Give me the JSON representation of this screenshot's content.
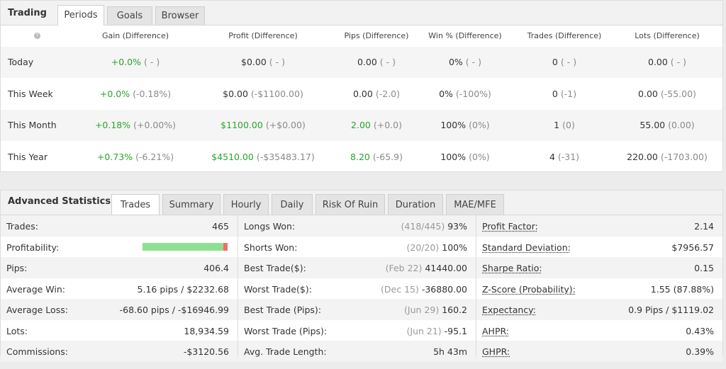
{
  "trading": {
    "title": "Trading",
    "tabs": [
      "Periods",
      "Goals",
      "Browser"
    ],
    "headers": [
      "Gain (Difference)",
      "Profit (Difference)",
      "Pips (Difference)",
      "Win % (Difference)",
      "Trades (Difference)",
      "Lots (Difference)"
    ],
    "rows": [
      {
        "label": "Today",
        "gain": "+0.0%",
        "gain_d": "( - )",
        "profit": "$0.00",
        "profit_d": "( - )",
        "pips": "0.00",
        "pips_d": "( - )",
        "win": "0%",
        "win_d": "( - )",
        "trades": "0",
        "trades_d": "( - )",
        "lots": "0.00",
        "lots_d": "( - )"
      },
      {
        "label": "This Week",
        "gain": "+0.0%",
        "gain_d": "(-0.18%)",
        "profit": "$0.00",
        "profit_d": "(-$1100.00)",
        "pips": "0.00",
        "pips_d": "(-2.0)",
        "win": "0%",
        "win_d": "(-100%)",
        "trades": "0",
        "trades_d": "(-1)",
        "lots": "0.00",
        "lots_d": "(-55.00)"
      },
      {
        "label": "This Month",
        "gain": "+0.18%",
        "gain_d": "(+0.00%)",
        "profit": "$1100.00",
        "profit_d": "(+$0.00)",
        "pips": "2.00",
        "pips_d": "(+0.0)",
        "win": "100%",
        "win_d": "(0%)",
        "trades": "1",
        "trades_d": "(0)",
        "lots": "55.00",
        "lots_d": "(0.00)"
      },
      {
        "label": "This Year",
        "gain": "+0.73%",
        "gain_d": "(-6.21%)",
        "profit": "$4510.00",
        "profit_d": "(-$35483.17)",
        "pips": "8.20",
        "pips_d": "(-65.9)",
        "win": "100%",
        "win_d": "(0%)",
        "trades": "4",
        "trades_d": "(-31)",
        "lots": "220.00",
        "lots_d": "(-1703.00)"
      }
    ]
  },
  "advanced": {
    "title": "Advanced Statistics",
    "tabs": [
      "Trades",
      "Summary",
      "Hourly",
      "Daily",
      "Risk Of Ruin",
      "Duration",
      "MAE/MFE"
    ],
    "col1": [
      {
        "label": "Trades:",
        "value": "465"
      },
      {
        "label": "Profitability:",
        "value": ""
      },
      {
        "label": "Pips:",
        "value": "406.4"
      },
      {
        "label": "Average Win:",
        "value": "5.16 pips / $2232.68"
      },
      {
        "label": "Average Loss:",
        "value": "-68.60 pips / -$16946.99"
      },
      {
        "label": "Lots:",
        "value": "18,934.59"
      },
      {
        "label": "Commissions:",
        "value": "-$3120.56"
      }
    ],
    "profitability_win_fraction": 0.95,
    "col2": [
      {
        "label": "Longs Won:",
        "extra": "(418/445)",
        "value": "93%"
      },
      {
        "label": "Shorts Won:",
        "extra": "(20/20)",
        "value": "100%"
      },
      {
        "label": "Best Trade($):",
        "extra": "(Feb 22)",
        "value": "41440.00"
      },
      {
        "label": "Worst Trade($):",
        "extra": "(Dec 15)",
        "value": "-36880.00"
      },
      {
        "label": "Best Trade (Pips):",
        "extra": "(Jun 29)",
        "value": "160.2"
      },
      {
        "label": "Worst Trade (Pips):",
        "extra": "(Jun 21)",
        "value": "-95.1"
      },
      {
        "label": "Avg. Trade Length:",
        "extra": "",
        "value": "5h 43m"
      }
    ],
    "col3": [
      {
        "label": "Profit Factor:",
        "value": "2.14"
      },
      {
        "label": "Standard Deviation:",
        "value": "$7956.57"
      },
      {
        "label": "Sharpe Ratio:",
        "value": "0.15"
      },
      {
        "label": "Z-Score (Probability):",
        "value": "1.55 (87.88%)"
      },
      {
        "label": "Expectancy:",
        "value": "0.9 Pips / $1119.02"
      },
      {
        "label": "AHPR:",
        "value": "0.43%"
      },
      {
        "label": "GHPR:",
        "value": "0.39%"
      }
    ],
    "colors": {
      "win": "#8ee08e",
      "loss": "#f07070",
      "positive": "#2aa52a"
    }
  }
}
